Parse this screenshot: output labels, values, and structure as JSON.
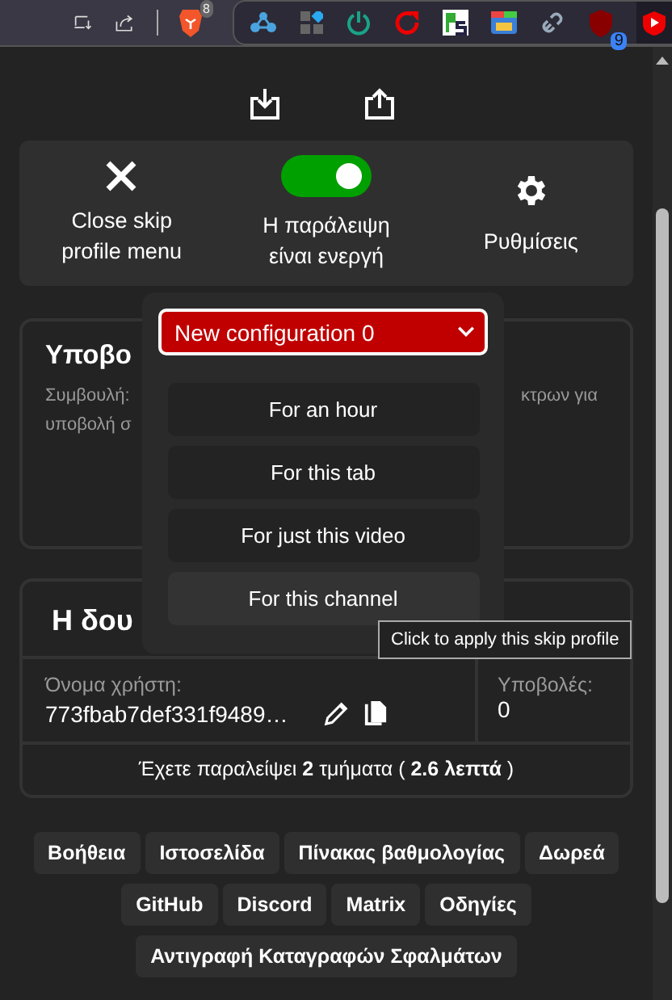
{
  "browser_toolbar": {
    "brave_badge": "8",
    "extension_badge": "9"
  },
  "controls": {
    "close_label": "Close skip profile menu",
    "toggle": {
      "label": "Η παράλειψη είναι ενεργή",
      "on": true
    },
    "settings_label": "Ρυθμίσεις"
  },
  "profile_menu": {
    "select_value": "New configuration 0",
    "options": [
      {
        "label": "For an hour",
        "hovered": false
      },
      {
        "label": "For this tab",
        "hovered": false
      },
      {
        "label": "For just this video",
        "hovered": false
      },
      {
        "label": "For this channel",
        "hovered": true
      }
    ]
  },
  "tooltip": "Click to apply this skip profile",
  "submit_card": {
    "title": "Υποβο",
    "tip_left": [
      "Συμβουλή:",
      "υποβολή σ"
    ],
    "tip_right": "κτρων για"
  },
  "stats_card": {
    "title": "Η δου",
    "username_label": "Όνομα χρήστη:",
    "username": "773fbab7def331f9489…",
    "submissions_label": "Υποβολές:",
    "submissions": "0",
    "summary": "Έχετε παραλείψει **2** τμήματα ( **2.6 λεπτά** )"
  },
  "links": [
    "Βοήθεια",
    "Ιστοσελίδα",
    "Πίνακας βαθμολογίας",
    "Δωρεά",
    "GitHub",
    "Discord",
    "Matrix",
    "Οδηγίες",
    "Αντιγραφή Καταγραφών Σφαλμάτων"
  ]
}
